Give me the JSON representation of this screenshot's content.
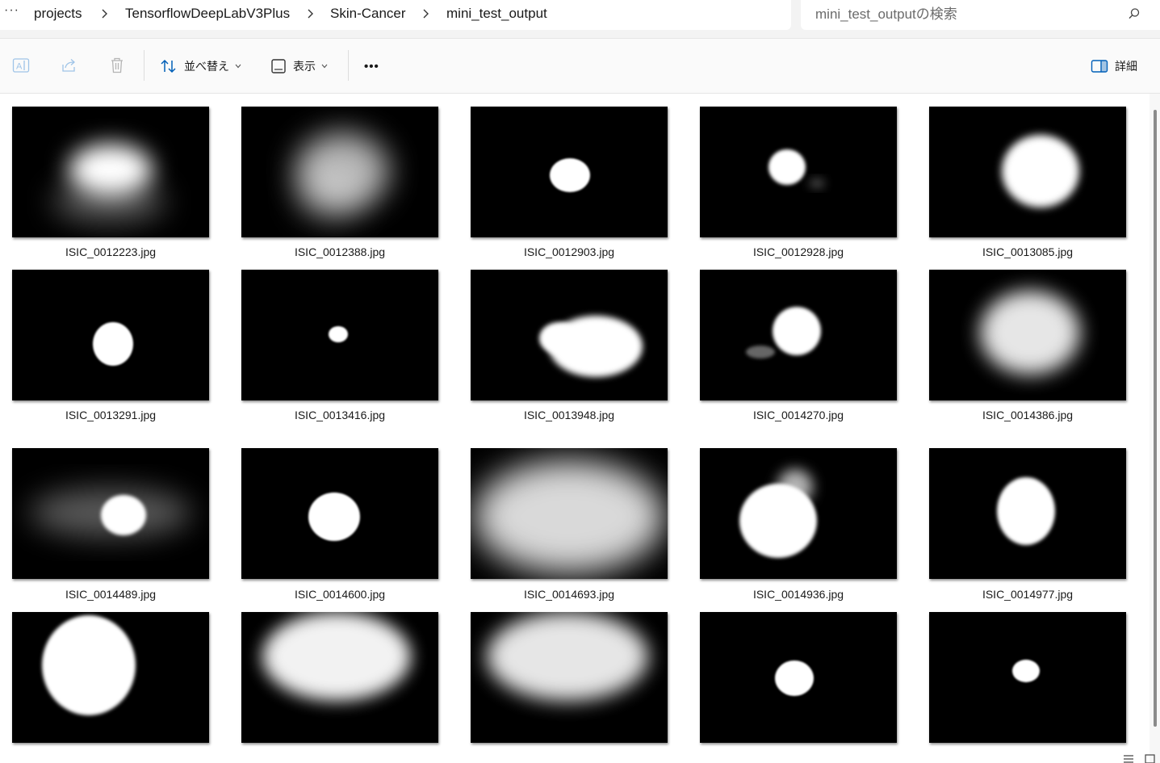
{
  "address": {
    "more": "···",
    "crumbs": [
      "projects",
      "TensorflowDeepLabV3Plus",
      "Skin-Cancer",
      "mini_test_output"
    ],
    "search_placeholder": "mini_test_outputの検索"
  },
  "toolbar": {
    "sort_label": "並べ替え",
    "view_label": "表示",
    "more": "•••",
    "details_label": "詳細"
  },
  "files": [
    "ISIC_0012223.jpg",
    "ISIC_0012388.jpg",
    "ISIC_0012903.jpg",
    "ISIC_0012928.jpg",
    "ISIC_0013085.jpg",
    "ISIC_0013291.jpg",
    "ISIC_0013416.jpg",
    "ISIC_0013948.jpg",
    "ISIC_0014270.jpg",
    "ISIC_0014386.jpg",
    "ISIC_0014489.jpg",
    "ISIC_0014600.jpg",
    "ISIC_0014693.jpg",
    "ISIC_0014936.jpg",
    "ISIC_0014977.jpg",
    "",
    "",
    "",
    "",
    ""
  ],
  "colors": {
    "accent": "#005fb8",
    "thumb_bg": "#000000"
  }
}
